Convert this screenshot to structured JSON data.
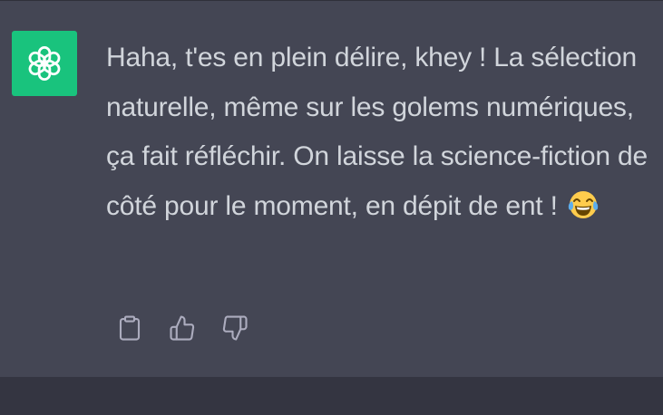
{
  "message": {
    "role": "assistant",
    "avatar_icon": "openai-logo-icon",
    "avatar_color": "#19c37d",
    "text": "Haha, t'es en plein délire, khey ! La sélection naturelle, même sur les golems numériques, ça fait réfléchir. On laisse la science-fiction de côté pour le moment, en dépit de ent !",
    "emoji_icon": "face-with-tears-of-joy-icon"
  },
  "actions": [
    {
      "name": "copy-button",
      "icon": "clipboard-icon"
    },
    {
      "name": "thumbs-up-button",
      "icon": "thumbs-up-icon"
    },
    {
      "name": "thumbs-down-button",
      "icon": "thumbs-down-icon"
    }
  ],
  "colors": {
    "message_background": "#444654",
    "page_background": "#343541",
    "text": "#d1d5db",
    "icon": "#acacbe"
  }
}
